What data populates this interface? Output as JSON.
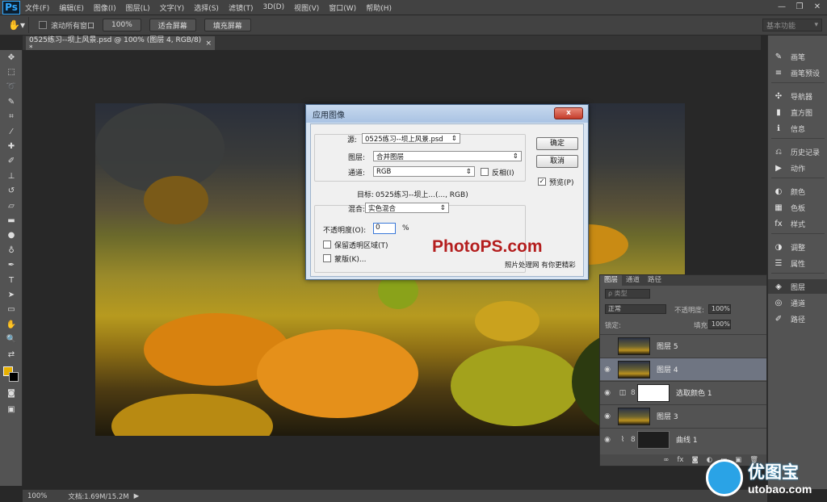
{
  "menubar": {
    "app": "Ps",
    "items": [
      "文件(F)",
      "编辑(E)",
      "图像(I)",
      "图层(L)",
      "文字(Y)",
      "选择(S)",
      "滤镜(T)",
      "3D(D)",
      "视图(V)",
      "窗口(W)",
      "帮助(H)"
    ],
    "minimize": "—",
    "restore": "❐",
    "close": "✕"
  },
  "options": {
    "scroll_all_label": "滚动所有窗口",
    "zoom_100": "100%",
    "fit_screen": "适合屏幕",
    "fill_screen": "填充屏幕",
    "workspace": "基本功能"
  },
  "document": {
    "tab_title": "0525练习--坝上风景.psd @ 100% (图层 4, RGB/8) *",
    "tab_close": "×"
  },
  "status": {
    "zoom": "100%",
    "doc_size": "文档:1.69M/15.2M"
  },
  "dialog": {
    "title": "应用图像",
    "close": "x",
    "source_label": "源:",
    "source_value": "0525练习--坝上风景.psd",
    "layer_label": "图层:",
    "layer_value": "合并图层",
    "channel_label": "通道:",
    "channel_value": "RGB",
    "invert_label": "反相(I)",
    "target_label": "目标:",
    "target_value": "0525练习--坝上...(..., RGB)",
    "blend_label": "混合:",
    "blend_value": "实色混合",
    "opacity_label": "不透明度(O):",
    "opacity_value": "0",
    "opacity_unit": "%",
    "preserve_label": "保留透明区域(T)",
    "mask_label": "蒙版(K)...",
    "ok": "确定",
    "cancel": "取消",
    "preview_label": "预览(P)",
    "preview_checked": "✓"
  },
  "watermark": {
    "logo": "PhotoPS.com",
    "sub": "照片处理网 有你更精彩"
  },
  "right_panel": [
    {
      "icon": "brush-icon",
      "glyph": "✎",
      "label": "画笔"
    },
    {
      "icon": "brush-presets-icon",
      "glyph": "≡",
      "label": "画笔预设"
    },
    {
      "icon": "navigator-icon",
      "glyph": "✣",
      "label": "导航器"
    },
    {
      "icon": "histogram-icon",
      "glyph": "▮",
      "label": "直方图"
    },
    {
      "icon": "info-icon",
      "glyph": "ℹ",
      "label": "信息"
    },
    {
      "icon": "history-icon",
      "glyph": "⎌",
      "label": "历史记录"
    },
    {
      "icon": "actions-icon",
      "glyph": "▶",
      "label": "动作"
    },
    {
      "icon": "color-icon",
      "glyph": "◐",
      "label": "颜色"
    },
    {
      "icon": "swatches-icon",
      "glyph": "▦",
      "label": "色板"
    },
    {
      "icon": "styles-icon",
      "glyph": "fx",
      "label": "样式"
    },
    {
      "icon": "adjustments-icon",
      "glyph": "◑",
      "label": "调整"
    },
    {
      "icon": "properties-icon",
      "glyph": "☰",
      "label": "属性"
    },
    {
      "icon": "layers-icon",
      "glyph": "◈",
      "label": "图层"
    },
    {
      "icon": "channels-icon",
      "glyph": "◎",
      "label": "通道"
    },
    {
      "icon": "paths-icon",
      "glyph": "✐",
      "label": "路径"
    }
  ],
  "layers_panel": {
    "tabs": [
      "图层",
      "通道",
      "路径"
    ],
    "kind_filter": "ρ 类型",
    "blend_mode": "正常",
    "opacity_label": "不透明度:",
    "opacity_value": "100%",
    "lock_label": "锁定:",
    "fill_label": "填充:",
    "fill_value": "100%",
    "layers": [
      {
        "name": "图层 5",
        "visible": false
      },
      {
        "name": "图层 4",
        "visible": true
      },
      {
        "name": "选取颜色 1",
        "visible": true
      },
      {
        "name": "图层 3",
        "visible": true
      },
      {
        "name": "曲线 1",
        "visible": true
      }
    ],
    "footer": [
      "∞",
      "fx",
      "◙",
      "◐",
      "▭",
      "▣",
      "🗑"
    ]
  },
  "brand": {
    "title": "优图宝",
    "url": "utobao.com"
  },
  "colors": {
    "foreground": "#e7b000",
    "background": "#000000",
    "accent": "#31a8ff"
  }
}
